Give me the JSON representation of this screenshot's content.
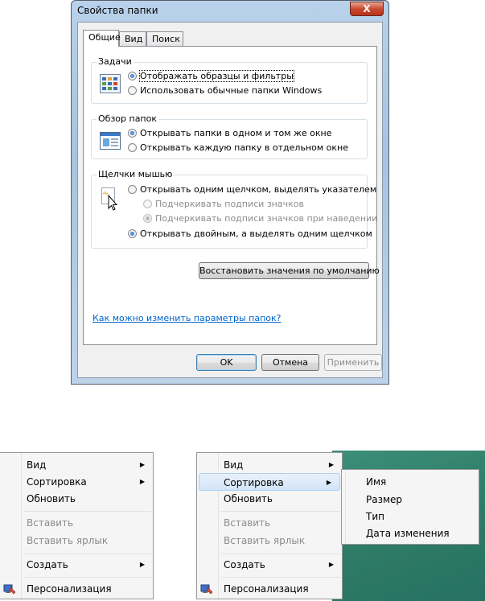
{
  "dialog": {
    "title": "Свойства папки",
    "close_label": "X",
    "tabs": [
      {
        "label": "Общие"
      },
      {
        "label": "Вид"
      },
      {
        "label": "Поиск"
      }
    ],
    "tasks": {
      "title": "Задачи",
      "options": [
        {
          "label": "Отображать образцы и фильтры",
          "checked": true
        },
        {
          "label": "Использовать обычные папки Windows",
          "checked": false
        }
      ]
    },
    "browse": {
      "title": "Обзор папок",
      "options": [
        {
          "label": "Открывать папки в одном и том же окне",
          "checked": true
        },
        {
          "label": "Открывать каждую папку в отдельном окне",
          "checked": false
        }
      ]
    },
    "clicks": {
      "title": "Щелчки мышью",
      "options": [
        {
          "label": "Открывать одним щелчком, выделять указателем",
          "checked": false
        },
        {
          "label": "Подчеркивать подписи значков",
          "checked": false,
          "disabled": true
        },
        {
          "label": "Подчеркивать подписи значков при наведении",
          "checked": true,
          "disabled": true
        },
        {
          "label": "Открывать двойным, а выделять одним щелчком",
          "checked": true
        }
      ]
    },
    "restore_label": "Восстановить значения по умолчанию",
    "help_link": "Как можно изменить параметры папок?",
    "buttons": {
      "ok": "OK",
      "cancel": "Отмена",
      "apply": "Применить"
    }
  },
  "menu_left": {
    "items": [
      {
        "label": "Вид",
        "submenu": true
      },
      {
        "label": "Сортировка",
        "submenu": true
      },
      {
        "label": "Обновить"
      },
      {
        "label": "Вставить",
        "disabled": true
      },
      {
        "label": "Вставить ярлык",
        "disabled": true
      },
      {
        "label": "Создать",
        "submenu": true
      },
      {
        "label": "Персонализация",
        "icon": "personalize-icon"
      }
    ]
  },
  "menu_right": {
    "items": [
      {
        "label": "Вид",
        "submenu": true
      },
      {
        "label": "Сортировка",
        "submenu": true,
        "highlighted": true
      },
      {
        "label": "Обновить"
      },
      {
        "label": "Вставить",
        "disabled": true
      },
      {
        "label": "Вставить ярлык",
        "disabled": true
      },
      {
        "label": "Создать",
        "submenu": true
      },
      {
        "label": "Персонализация",
        "icon": "personalize-icon"
      }
    ],
    "submenu": [
      {
        "label": "Имя"
      },
      {
        "label": "Размер"
      },
      {
        "label": "Тип"
      },
      {
        "label": "Дата изменения"
      }
    ]
  },
  "colors": {
    "desktop": "#2f7c66",
    "link": "#0066cc",
    "close": "#c94a2f"
  }
}
